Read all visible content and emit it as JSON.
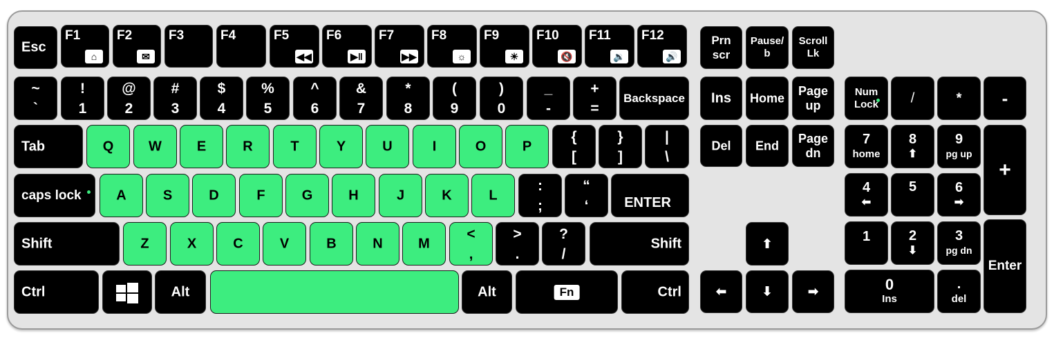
{
  "colors": {
    "highlight": "#3ded7f",
    "key": "#000000",
    "board": "#e4e4e4"
  },
  "keys": {
    "esc": "Esc",
    "f1": "F1",
    "f2": "F2",
    "f3": "F3",
    "f4": "F4",
    "f5": "F5",
    "f6": "F6",
    "f7": "F7",
    "f8": "F8",
    "f9": "F9",
    "f10": "F10",
    "f11": "F11",
    "f12": "F12",
    "f1_icon": "⌂",
    "f2_icon": "✉",
    "f5_icon": "◀◀",
    "f6_icon": "▶‖",
    "f7_icon": "▶▶",
    "f8_icon": "☼",
    "f9_icon": "☀",
    "f10_icon": "🔇",
    "f11_icon": "🔉",
    "f12_icon": "🔊",
    "prn_top": "Prn",
    "prn_bot": "scr",
    "pause_top": "Pause/",
    "pause_bot": "b",
    "scroll_top": "Scroll",
    "scroll_bot": "Lk",
    "tilde_top": "~",
    "tilde_bot": "`",
    "n1_top": "!",
    "n1_bot": "1",
    "n2_top": "@",
    "n2_bot": "2",
    "n3_top": "#",
    "n3_bot": "3",
    "n4_top": "$",
    "n4_bot": "4",
    "n5_top": "%",
    "n5_bot": "5",
    "n6_top": "^",
    "n6_bot": "6",
    "n7_top": "&",
    "n7_bot": "7",
    "n8_top": "*",
    "n8_bot": "8",
    "n9_top": "(",
    "n9_bot": "9",
    "n0_top": ")",
    "n0_bot": "0",
    "minus_top": "_",
    "minus_bot": "-",
    "plus_top": "+",
    "plus_bot": "=",
    "backspace": "Backspace",
    "ins": "Ins",
    "home": "Home",
    "pgup_top": "Page",
    "pgup_bot": "up",
    "numlock_top": "Num",
    "numlock_bot": "Lock",
    "kp_slash": "/",
    "kp_star": "*",
    "kp_minus": "-",
    "tab": "Tab",
    "q": "Q",
    "w": "W",
    "e": "E",
    "r": "R",
    "t": "T",
    "y": "Y",
    "u": "U",
    "i": "I",
    "o": "O",
    "p": "P",
    "lbrace_top": "{",
    "lbrace_bot": "[",
    "rbrace_top": "}",
    "rbrace_bot": "]",
    "pipe_top": "|",
    "pipe_bot": "\\",
    "del": "Del",
    "end": "End",
    "pgdn_top": "Page",
    "pgdn_bot": "dn",
    "kp7_top": "7",
    "kp7_bot": "home",
    "kp8_top": "8",
    "kp8_bot": "⬆",
    "kp9_top": "9",
    "kp9_bot": "pg up",
    "kp_plus": "+",
    "capslock": "caps lock",
    "a": "A",
    "s": "S",
    "d": "D",
    "f": "F",
    "g": "G",
    "h": "H",
    "j": "J",
    "k": "K",
    "l": "L",
    "colon_top": ":",
    "colon_bot": ";",
    "quote_top": "“",
    "quote_bot": "‘",
    "enter": "ENTER",
    "kp4_top": "4",
    "kp4_bot": "⬅",
    "kp5": "5",
    "kp6_top": "6",
    "kp6_bot": "➡",
    "lshift": "Shift",
    "z": "Z",
    "x": "X",
    "c": "C",
    "v": "V",
    "b": "B",
    "n": "N",
    "m": "M",
    "lt_top": "<",
    "lt_bot": ",",
    "gt_top": ">",
    "gt_bot": ".",
    "question_top": "?",
    "question_bot": "/",
    "rshift": "Shift",
    "arrow_up": "⬆",
    "kp1": "1",
    "kp2_top": "2",
    "kp2_bot": "⬇",
    "kp3_top": "3",
    "kp3_bot": "pg dn",
    "kp_enter": "Enter",
    "lctrl": "Ctrl",
    "lalt": "Alt",
    "ralt": "Alt",
    "fn": "Fn",
    "rctrl": "Ctrl",
    "arrow_left": "⬅",
    "arrow_down": "⬇",
    "arrow_right": "➡",
    "kp0_top": "0",
    "kp0_bot": "Ins",
    "kpdot_top": ".",
    "kpdot_bot": "del"
  }
}
